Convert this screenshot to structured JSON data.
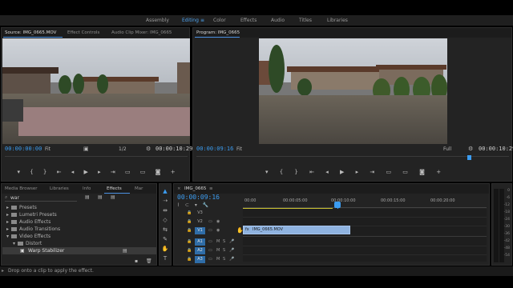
{
  "workspaces": [
    {
      "label": "Assembly",
      "active": false
    },
    {
      "label": "Editing",
      "active": true
    },
    {
      "label": "Color",
      "active": false
    },
    {
      "label": "Effects",
      "active": false
    },
    {
      "label": "Audio",
      "active": false
    },
    {
      "label": "Titles",
      "active": false
    },
    {
      "label": "Libraries",
      "active": false
    }
  ],
  "source": {
    "tabs": [
      "Source: IMG_0665.MOV",
      "Effect Controls",
      "Audio Clip Mixer: IMG_0665"
    ],
    "timecode": "00:00:00:00",
    "fit": "Fit",
    "resolution": "1/2",
    "duration": "00:00:10:29"
  },
  "program": {
    "tab": "Program: IMG_0665",
    "timecode": "00:00:09:16",
    "fit": "Fit",
    "resolution": "Full",
    "duration": "00:00:10:29"
  },
  "project": {
    "tabs": [
      "Media Browser",
      "Libraries",
      "Info",
      "Effects",
      "Mar"
    ],
    "search_value": "war",
    "tree": [
      {
        "label": "Presets",
        "depth": 0,
        "open": false
      },
      {
        "label": "Lumetri Presets",
        "depth": 0,
        "open": false
      },
      {
        "label": "Audio Effects",
        "depth": 0,
        "open": false
      },
      {
        "label": "Audio Transitions",
        "depth": 0,
        "open": false
      },
      {
        "label": "Video Effects",
        "depth": 0,
        "open": true
      },
      {
        "label": "Distort",
        "depth": 1,
        "open": true
      },
      {
        "label": "Warp Stabilizer",
        "depth": 2,
        "open": false
      }
    ]
  },
  "timeline": {
    "sequence_name": "IMG_0665",
    "timecode": "00:00:09:16",
    "ruler": [
      "00:00",
      "00:00:05:00",
      "00:00:10:00",
      "00:00:15:00",
      "00:00:20:00"
    ],
    "tracks": [
      "V3",
      "V2",
      "V1",
      "A1",
      "A2",
      "A3"
    ],
    "clip_name": "IMG_0665.MOV"
  },
  "meters": [
    "0",
    "-6",
    "-12",
    "-18",
    "-24",
    "-30",
    "-36",
    "-42",
    "-48",
    "-54"
  ],
  "status_bar": "Drop onto a clip to apply the effect."
}
